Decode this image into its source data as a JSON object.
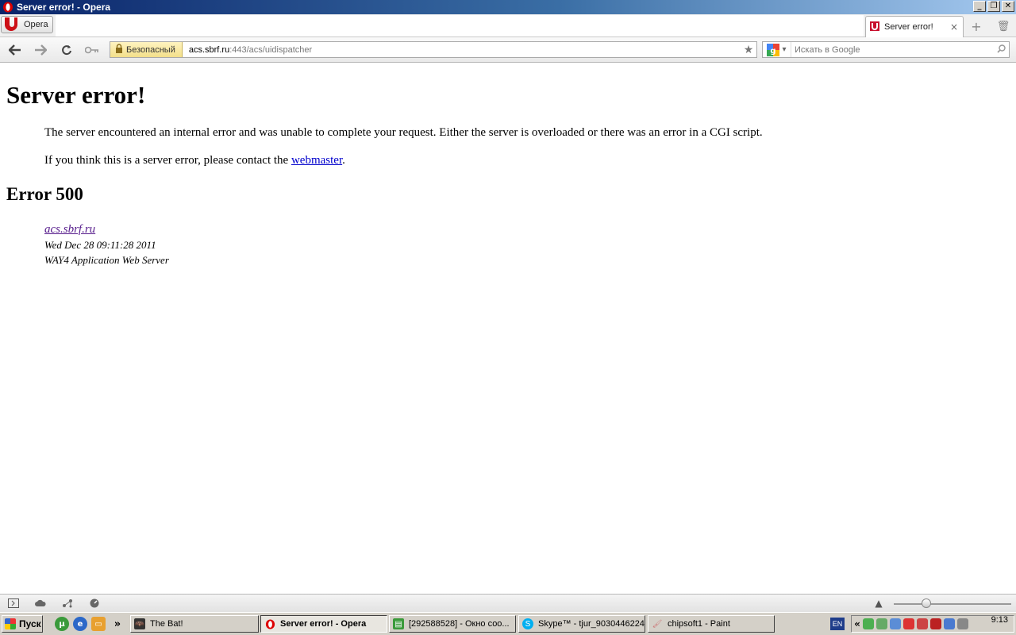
{
  "window": {
    "title": "Server error! - Opera",
    "controls": {
      "minimize": "_",
      "maximize": "❐",
      "close": "✕"
    }
  },
  "tabbar": {
    "menu_label": "Opera",
    "tabs": [
      {
        "label": "Server error!",
        "close": "×"
      }
    ],
    "new_tab": "+",
    "trash": "🗑"
  },
  "toolbar": {
    "security_label": "Безопасный",
    "url_host": "acs.sbrf.ru",
    "url_path": ":443/acs/uidispatcher",
    "search_placeholder": "Искать в Google"
  },
  "page": {
    "heading": "Server error!",
    "message": "The server encountered an internal error and was unable to complete your request. Either the server is overloaded or there was an error in a CGI script.",
    "contact_prefix": "If you think this is a server error, please contact the ",
    "contact_link": "webmaster",
    "contact_suffix": ".",
    "error_heading": "Error 500",
    "address": {
      "host": "acs.sbrf.ru",
      "date": "Wed Dec 28 09:11:28 2011",
      "server": "WAY4 Application Web Server"
    }
  },
  "taskbar": {
    "start_label": "Пуск",
    "more": "»",
    "tasks": [
      {
        "label": "The Bat!"
      },
      {
        "label": "Server error! - Opera"
      },
      {
        "label": "[292588528] - Окно соо..."
      },
      {
        "label": "Skype™ - tjur_9030446224"
      },
      {
        "label": "chipsoft1 - Paint"
      }
    ],
    "lang": "EN",
    "tray_chevron": "«",
    "clock": "9:13"
  }
}
